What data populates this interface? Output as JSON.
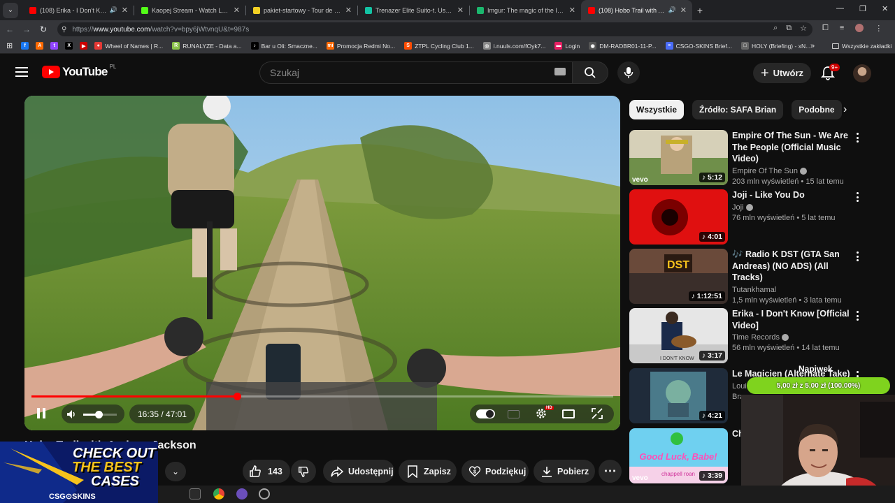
{
  "browser": {
    "tabs": [
      {
        "title": "(108) Erika - I Don't Know [",
        "favicon_color": "#ff0000",
        "audio": true
      },
      {
        "title": "Kaopej Stream - Watch Live on",
        "favicon_color": "#53fc18",
        "audio": false
      },
      {
        "title": "pakiet-startowy - Tour de Polog",
        "favicon_color": "#f2d024",
        "audio": false
      },
      {
        "title": "Trenazer Elite Suito-t. Uszkodz",
        "favicon_color": "#13c2a3",
        "audio": false
      },
      {
        "title": "Imgur: The magic of the Interne",
        "favicon_color": "#1bb76e",
        "audio": false
      },
      {
        "title": "(108) Hobo Trail with Andre",
        "favicon_color": "#ff0000",
        "audio": true,
        "active": true
      }
    ],
    "url_prefix": "https://",
    "url_host": "www.youtube.com",
    "url_rest": "/watch?v=bpy6jWtvnqU&t=987s",
    "bookmarks": [
      {
        "label": "",
        "color": "#1877f2",
        "glyph": "f"
      },
      {
        "label": "",
        "color": "#ff6a00",
        "glyph": "A"
      },
      {
        "label": "",
        "color": "#9146ff",
        "glyph": "t"
      },
      {
        "label": "",
        "color": "#000000",
        "glyph": "X"
      },
      {
        "label": "",
        "color": "#cc0000",
        "glyph": "▶"
      },
      {
        "label": "Wheel of Names | R...",
        "color": "#e53935",
        "glyph": "●"
      },
      {
        "label": "RUNALYZE - Data a...",
        "color": "#8bc34a",
        "glyph": "R"
      },
      {
        "label": "Bar u Oli: Smaczne...",
        "color": "#000000",
        "glyph": "♪"
      },
      {
        "label": "Promocja Redmi No...",
        "color": "#ff6900",
        "glyph": "mi"
      },
      {
        "label": "ZTPL Cycling Club 1...",
        "color": "#fc4c02",
        "glyph": "S"
      },
      {
        "label": "i.nuuls.com/fOyk7...",
        "color": "#888888",
        "glyph": "◎"
      },
      {
        "label": "Login",
        "color": "#e91e63",
        "glyph": "▬"
      },
      {
        "label": "DM-RADBR01-11-P...",
        "color": "#555555",
        "glyph": "◉"
      },
      {
        "label": "CSGO-SKINS Brief...",
        "color": "#4a6cf7",
        "glyph": "≡"
      },
      {
        "label": "HOLY (Briefing) - xN...",
        "color": "#666666",
        "glyph": "□"
      }
    ],
    "bookmarks_more": "»",
    "all_bookmarks": "Wszystkie zakładki"
  },
  "youtube": {
    "logo_text": "YouTube",
    "country_code": "PL",
    "search_placeholder": "Szukaj",
    "create_label": "Utwórz",
    "notifications_badge": "9+"
  },
  "player": {
    "time_current": "16:35",
    "time_total": "47:01",
    "time_display": "16:35 / 47:01",
    "progress_fraction": 0.353,
    "volume_fraction": 0.45,
    "quality_badge": "HD"
  },
  "video": {
    "title": "Hobo Trail with Andrew Jackson",
    "likes": "143",
    "share_label": "Udostępnij",
    "save_label": "Zapisz",
    "thanks_label": "Podziękuj",
    "download_label": "Pobierz"
  },
  "sidebar": {
    "chips": [
      "Wszystkie",
      "Źródło: SAFA Brian",
      "Podobne"
    ],
    "recommendations": [
      {
        "title": "Empire Of The Sun - We Are The People (Official Music Video)",
        "channel": "Empire Of The Sun",
        "verified": true,
        "views": "203 mln wyświetleń • 15 lat temu",
        "duration": "5:12",
        "thumb": "empire",
        "brand": "vevo"
      },
      {
        "title": "Joji - Like You Do",
        "channel": "Joji",
        "verified": true,
        "views": "76 mln wyświetleń • 5 lat temu",
        "duration": "4:01",
        "thumb": "joji",
        "brand": ""
      },
      {
        "title": "🎶 Radio K DST (GTA San Andreas) (NO ADS) (All Tracks)",
        "channel": "Tutankhamal",
        "verified": false,
        "views": "1,5 mln wyświetleń • 3 lata temu",
        "duration": "1:12:51",
        "thumb": "dst",
        "brand": ""
      },
      {
        "title": "Erika - I Don't Know [Official Video]",
        "channel": "Time Records",
        "verified": true,
        "views": "56 mln wyświetleń • 14 lat temu",
        "duration": "3:17",
        "thumb": "erika",
        "brand": ""
      },
      {
        "title": "Le Magicien (Alternate Take)",
        "channel": "Loui",
        "verified": false,
        "views": "Bra",
        "duration": "4:21",
        "thumb": "magicien",
        "brand": ""
      },
      {
        "title": "Ch Ba",
        "channel": "",
        "verified": false,
        "views": "",
        "duration": "3:39",
        "thumb": "luck",
        "brand": "vevo"
      }
    ]
  },
  "overlay": {
    "donation_label": "Napiwek",
    "donation_amount": "5,00 zł z 5,00 zł (100.00%)",
    "ad_line1": "CHECK OUT",
    "ad_line2": "THE BEST",
    "ad_line3": "CASES",
    "ad_brand": "CSG⊙SKINS",
    "thumb_text_dst": "DST",
    "thumb_text_luck": "Good Luck, Babe!",
    "thumb_text_chappell": "chappell roan",
    "thumb_text_erika": "I DON'T KNOW"
  }
}
